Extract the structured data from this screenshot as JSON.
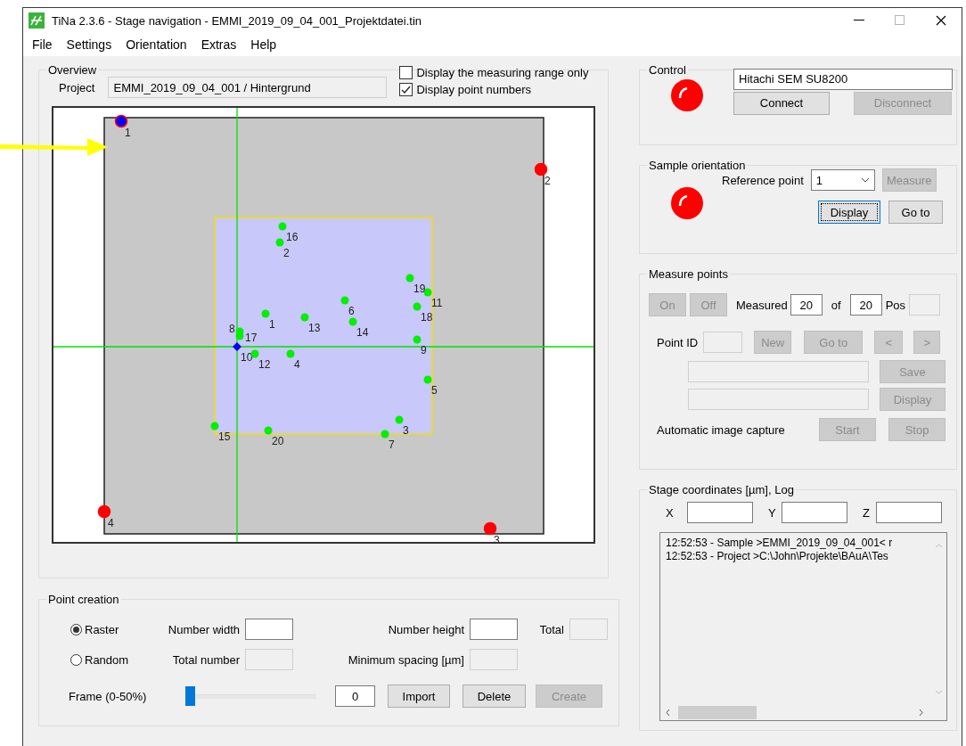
{
  "window": {
    "title": "TiNa 2.3.6 - Stage navigation - EMMI_2019_09_04_001_Projektdatei.tin",
    "maximize_disabled": true
  },
  "menu": [
    "File",
    "Settings",
    "Orientation",
    "Extras",
    "Help"
  ],
  "overview": {
    "title": "Overview",
    "project_label": "Project",
    "project": "EMMI_2019_09_04_001 / Hintergrund",
    "options": [
      {
        "label": "Display the measuring range only",
        "checked": false
      },
      {
        "label": "Display point numbers",
        "checked": true
      }
    ],
    "reference_points": [
      {
        "label": "1",
        "current": true
      },
      {
        "label": "2",
        "current": false
      },
      {
        "label": "3",
        "current": false
      },
      {
        "label": "4",
        "current": false
      }
    ],
    "measure_points": [
      {
        "label": "1",
        "current": false
      },
      {
        "label": "2",
        "current": false
      },
      {
        "label": "3",
        "current": false
      },
      {
        "label": "4",
        "current": false
      },
      {
        "label": "5",
        "current": false
      },
      {
        "label": "6",
        "current": false
      },
      {
        "label": "7",
        "current": false
      },
      {
        "label": "8",
        "current": false
      },
      {
        "label": "9",
        "current": false
      },
      {
        "label": "10",
        "current": true
      },
      {
        "label": "11",
        "current": false
      },
      {
        "label": "12",
        "current": false
      },
      {
        "label": "13",
        "current": false
      },
      {
        "label": "14",
        "current": false
      },
      {
        "label": "15",
        "current": false
      },
      {
        "label": "16",
        "current": false
      },
      {
        "label": "17",
        "current": false
      },
      {
        "label": "18",
        "current": false
      },
      {
        "label": "19",
        "current": false
      },
      {
        "label": "20",
        "current": false
      }
    ]
  },
  "point_creation": {
    "title": "Point creation",
    "modes": [
      {
        "label": "Raster",
        "selected": true
      },
      {
        "label": "Random",
        "selected": false
      }
    ],
    "fields": [
      {
        "label": "Number width",
        "disabled": false
      },
      {
        "label": "Number height",
        "disabled": false
      },
      {
        "label": "Total",
        "disabled": true
      },
      {
        "label": "Total number",
        "disabled": true
      },
      {
        "label": "Minimum spacing [µm]",
        "disabled": true
      }
    ],
    "frame": {
      "label": "Frame (0-50%)",
      "level": 0,
      "value": "0"
    },
    "buttons": [
      {
        "label": "Import",
        "disabled": false
      },
      {
        "label": "Delete",
        "disabled": false
      },
      {
        "label": "Create",
        "disabled": true
      }
    ]
  },
  "control": {
    "title": "Control",
    "connected": false,
    "device": "Hitachi SEM SU8200",
    "buttons": [
      {
        "label": "Connect",
        "disabled": false
      },
      {
        "label": "Disconnect",
        "disabled": true
      }
    ]
  },
  "sample_orientation": {
    "title": "Sample orientation",
    "oriented": false,
    "reference_label": "Reference point",
    "reference_value": "1",
    "buttons": [
      {
        "label": "Measure",
        "disabled": true,
        "focused": false
      },
      {
        "label": "Display",
        "disabled": false,
        "focused": true
      },
      {
        "label": "Go to",
        "disabled": false,
        "focused": false
      }
    ]
  },
  "measure_points": {
    "title": "Measure points",
    "toggles": [
      {
        "label": "On",
        "disabled": true
      },
      {
        "label": "Off",
        "disabled": true
      }
    ],
    "measured_label": "Measured",
    "measured": "20",
    "of_label": "of",
    "total": "20",
    "pos_label": "Pos",
    "point_id_label": "Point ID",
    "nav_buttons": [
      {
        "label": "New",
        "disabled": true
      },
      {
        "label": "Go to",
        "disabled": true
      },
      {
        "label": "<",
        "disabled": true
      },
      {
        "label": ">",
        "disabled": true
      }
    ],
    "file_buttons": [
      {
        "label": "Save",
        "disabled": true
      },
      {
        "label": "Display",
        "disabled": true
      }
    ],
    "capture_label": "Automatic image capture",
    "capture_buttons": [
      {
        "label": "Start",
        "disabled": true
      },
      {
        "label": "Stop",
        "disabled": true
      }
    ]
  },
  "stage": {
    "title": "Stage coordinates [µm], Log",
    "axes": [
      {
        "label": "X"
      },
      {
        "label": "Y"
      },
      {
        "label": "Z"
      }
    ],
    "log": [
      "12:52:53 - Sample >EMMI_2019_09_04_001< r",
      "12:52:53 - Project >C:\\John\\Projekte\\BAuA\\Tes"
    ]
  }
}
